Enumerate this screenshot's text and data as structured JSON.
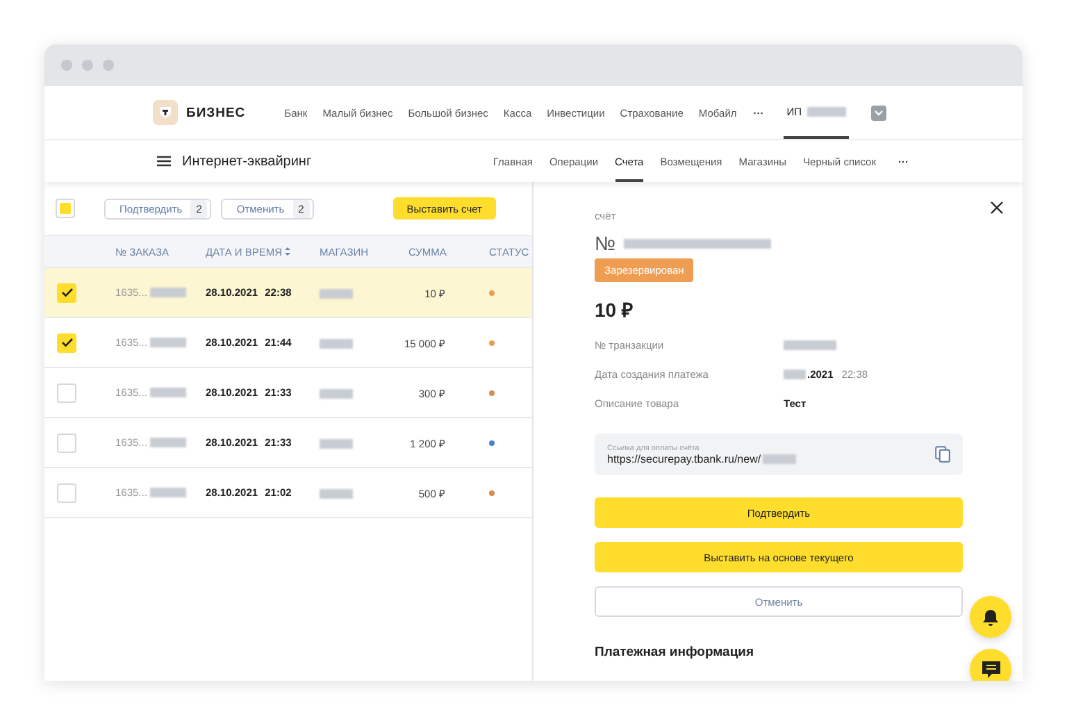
{
  "header": {
    "logo": "БИЗНЕС",
    "nav": [
      "Банк",
      "Малый бизнес",
      "Большой бизнес",
      "Касса",
      "Инвестиции",
      "Страхование",
      "Мобайл"
    ],
    "more": "···",
    "account": "ИП"
  },
  "subnav": {
    "title": "Интернет-эквайринг",
    "tabs": [
      {
        "label": "Главная",
        "selected": false
      },
      {
        "label": "Операции",
        "selected": false
      },
      {
        "label": "Счета",
        "selected": true
      },
      {
        "label": "Возмещения",
        "selected": false
      },
      {
        "label": "Магазины",
        "selected": false
      },
      {
        "label": "Черный список",
        "selected": false
      }
    ],
    "more": "···"
  },
  "toolbar": {
    "select_all_partial": true,
    "actions": [
      {
        "label": "Подтвердить",
        "count": "2"
      },
      {
        "label": "Отменить",
        "count": "2"
      }
    ],
    "primary": "Выставить счет"
  },
  "table": {
    "columns": [
      {
        "label": "№ ЗАКАЗА",
        "sortable": false
      },
      {
        "label": "ДАТА И ВРЕМЯ",
        "sortable": true
      },
      {
        "label": "МАГАЗИН",
        "sortable": false
      },
      {
        "label": "СУММА",
        "sortable": false
      },
      {
        "label": "СТАТУС",
        "sortable": false
      }
    ],
    "rows": [
      {
        "order": "1635...",
        "date": "28.10.2021",
        "time": "22:38",
        "amount": "10 ₽",
        "color": "#ef9a4f",
        "checked": true,
        "selected": true
      },
      {
        "order": "1635...",
        "date": "28.10.2021",
        "time": "21:44",
        "amount": "15 000 ₽",
        "color": "#ef9a4f",
        "checked": true,
        "selected": false
      },
      {
        "order": "1635...",
        "date": "28.10.2021",
        "time": "21:33",
        "amount": "300 ₽",
        "color": "#d98a4e",
        "checked": false,
        "selected": false
      },
      {
        "order": "1635...",
        "date": "28.10.2021",
        "time": "21:33",
        "amount": "1 200 ₽",
        "color": "#4a7fd1",
        "checked": false,
        "selected": false
      },
      {
        "order": "1635...",
        "date": "28.10.2021",
        "time": "21:02",
        "amount": "500 ₽",
        "color": "#d98a4e",
        "checked": false,
        "selected": false
      }
    ]
  },
  "detail": {
    "kind_label": "счёт",
    "number_prefix": "№",
    "status": "Зарезервирован",
    "amount": "10 ₽",
    "fields": [
      {
        "label": "№ транзакции",
        "redacted": true
      },
      {
        "label": "Дата создания платежа",
        "redacted": true,
        "value": ".2021",
        "time": "22:38"
      },
      {
        "label": "Описание товара",
        "redacted": false,
        "value": "Тест"
      }
    ],
    "link": {
      "caption": "Ссылка для оплаты счёта",
      "url": "https://securepay.tbank.ru/new/"
    },
    "buttons": [
      {
        "label": "Подтвердить",
        "kind": "primary"
      },
      {
        "label": "Выставить на основе текущего",
        "kind": "primary"
      },
      {
        "label": "Отменить",
        "kind": "secondary"
      }
    ],
    "section": "Платежная информация"
  }
}
